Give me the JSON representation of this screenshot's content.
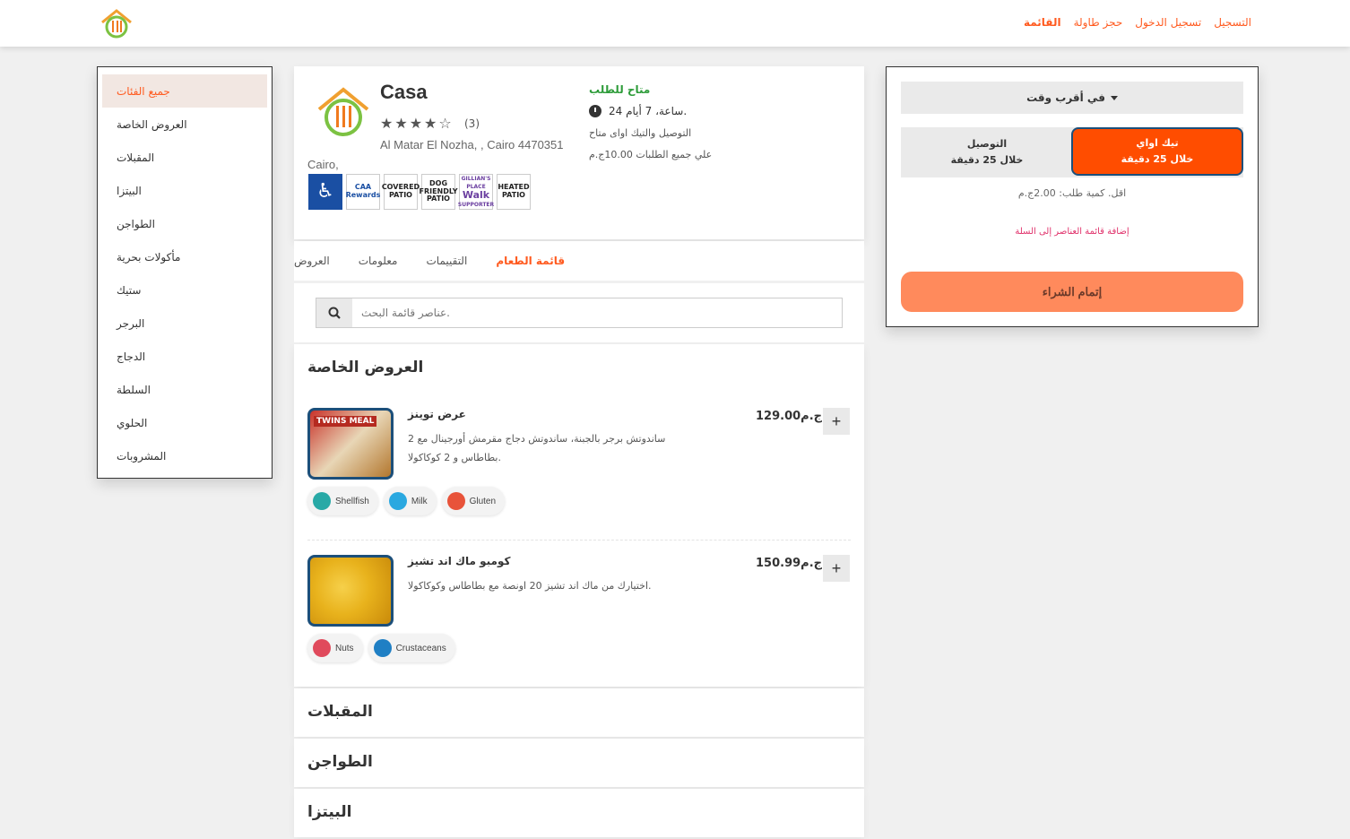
{
  "nav": {
    "register": "التسجيل",
    "login": "تسجيل الدخول",
    "reserve": "حجز طاولة",
    "menu": "القائمة"
  },
  "categories": [
    "جميع الفئات",
    "العروض الخاصة",
    "المقبلات",
    "البيتزا",
    "الطواجن",
    "مأكولات بحرية",
    "ستيك",
    "البرجر",
    "الدجاج",
    "السلطة",
    "الحلوي",
    "المشروبات"
  ],
  "restaurant": {
    "name": "Casa",
    "rating": 4,
    "review_count": "(3)",
    "address": "Al Matar El Nozha, , Cairo 4470351",
    "city": "Cairo,",
    "badges": {
      "caa": "CAA",
      "caa_sub": "Rewards",
      "covered_patio": "COVERED PATIO",
      "dog_patio": "DOG FRIENDLY PATIO",
      "walk": "Walk",
      "walk_top": "GILLIAN'S PLACE",
      "walk_sub": "SUPPORTER",
      "heated_patio": "HEATED PATIO"
    }
  },
  "availability": {
    "title": "متاح للطلب",
    "hours": "24 ساعة، 7 أيام.",
    "note1": "التوصيل والتيك اواى متاح",
    "note2": "علي جميع الطلبات 10.00ج.م"
  },
  "tabs": {
    "menu": "قائمة الطعام",
    "reviews": "التقييمات",
    "info": "معلومات",
    "offers": "العروض"
  },
  "search": {
    "placeholder": "عناصر قائمة البحث."
  },
  "sections": {
    "special": "العروض الخاصة",
    "appetizers": "المقبلات",
    "tagines": "الطواجن",
    "pizza": "البيتزا"
  },
  "items": [
    {
      "name": "عرض توينز",
      "desc": "ساندوتش برجر بالجبنة، ساندوتش دجاج مقرمش أورجينال مع 2 بطاطاس و 2 كوكاكولا.",
      "price": "ج.م129.00",
      "img_label": "TWINS MEAL",
      "allergens": [
        {
          "name": "Gluten",
          "color": "#e8533a"
        },
        {
          "name": "Milk",
          "color": "#2aa8e0"
        },
        {
          "name": "Shellfish",
          "color": "#28a9a6"
        }
      ]
    },
    {
      "name": "كومبو ماك اند تشيز",
      "desc": "اختيارك من ماك اند تشيز 20 اونصة مع بطاطاس وكوكاكولا.",
      "price": "ج.م150.99",
      "img_label": "",
      "allergens": [
        {
          "name": "Crustaceans",
          "color": "#1f7fc4"
        },
        {
          "name": "Nuts",
          "color": "#e04a5c"
        }
      ]
    }
  ],
  "cart": {
    "time": "في أقرب وقت",
    "delivery": "التوصيل",
    "delivery_time": "خلال 25 دقيقة",
    "pickup": "تيك اواي",
    "pickup_time": "خلال 25 دقيقة",
    "min_order": "اقل. كمية طلب: 2.00ج.م",
    "add_items": "إضافة قائمة العناصر إلى السلة",
    "checkout": "إتمام الشراء"
  },
  "colors": {
    "accent": "#ff5a1f",
    "pickup": "#ff4d00",
    "checkout": "#ff8a5c",
    "available": "#2e9c3a"
  }
}
